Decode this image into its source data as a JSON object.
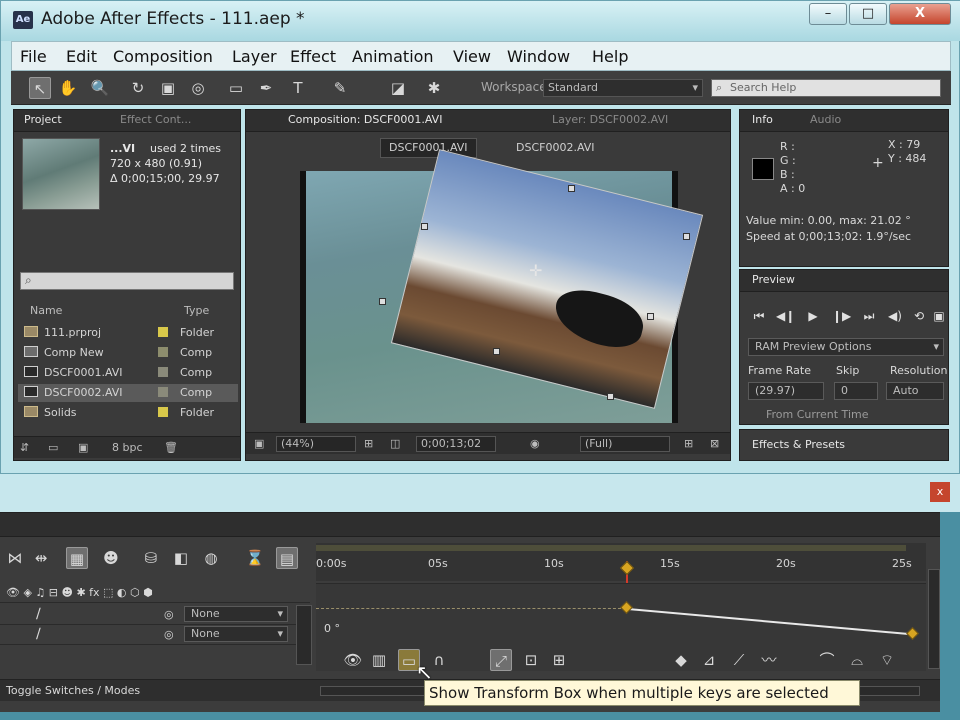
{
  "window": {
    "title": "Adobe After Effects - 111.aep *",
    "icon_text": "Ae",
    "controls": {
      "minimize": "–",
      "maximize": "□",
      "close": "X"
    }
  },
  "menu": [
    "File",
    "Edit",
    "Composition",
    "Layer",
    "Effect",
    "Animation",
    "View",
    "Window",
    "Help"
  ],
  "toolbar": {
    "tools": [
      "selection-tool-icon",
      "hand-tool-icon",
      "zoom-tool-icon",
      "rotation-tool-icon",
      "camera-tool-icon",
      "pan-behind-tool-icon",
      "rectangle-mask-tool-icon",
      "pen-tool-icon",
      "text-tool-icon",
      "brush-tool-icon",
      "eraser-tool-icon",
      "puppet-tool-icon"
    ],
    "tool_glyphs": [
      "↖",
      "✋",
      "🔍",
      "↻",
      "▣",
      "◎",
      "▭",
      "✒",
      "T",
      "✎",
      "◪",
      "✱"
    ],
    "workspace_label": "Workspace:",
    "workspace_value": "Standard",
    "search_placeholder": "Search Help"
  },
  "project_panel": {
    "tab_project": "Project",
    "tab_effect_controls": "Effect Cont...",
    "footage_name": "...VI",
    "footage_used": "used 2 times",
    "footage_size": "720 x 480 (0.91)",
    "footage_duration": "Δ 0;00;15;00, 29.97",
    "col_name": "Name",
    "col_type": "Type",
    "items": [
      {
        "name": "111.prproj",
        "type": "Folder",
        "icon": "folder",
        "label": "#d8c84a"
      },
      {
        "name": "Comp New",
        "type": "Comp",
        "icon": "comp",
        "label": "#8d8d6d"
      },
      {
        "name": "DSCF0001.AVI",
        "type": "Comp",
        "icon": "vid",
        "label": "#8a8a7a"
      },
      {
        "name": "DSCF0002.AVI",
        "type": "Comp",
        "icon": "vid",
        "label": "#8a8a7a"
      },
      {
        "name": "Solids",
        "type": "Folder",
        "icon": "folder",
        "label": "#d8c84a"
      }
    ],
    "footer_bpc": "8 bpc"
  },
  "composition_panel": {
    "tab_label": "Composition: DSCF0001.AVI",
    "tab_layer": "Layer: DSCF0002.AVI",
    "sub_tab_1": "DSCF0001.AVI",
    "sub_tab_2": "DSCF0002.AVI",
    "zoom": "(44%)",
    "timecode": "0;00;13;02",
    "resolution": "(Full)"
  },
  "info_panel": {
    "tab_info": "Info",
    "tab_audio": "Audio",
    "r": "R :",
    "g": "G :",
    "b": "B :",
    "a": "A : 0",
    "x": "X : 79",
    "y": "Y : 484",
    "value_line": "Value min: 0.00, max: 21.02 °",
    "speed_line": "Speed at 0;00;13;02: 1.9°/sec"
  },
  "preview_panel": {
    "tab": "Preview",
    "buttons": [
      "first-frame-icon",
      "prev-frame-icon",
      "play-icon",
      "next-frame-icon",
      "last-frame-icon",
      "audio-icon",
      "loop-icon",
      "ram-preview-icon"
    ],
    "button_glyphs": [
      "⏮",
      "◀❙",
      "▶",
      "❙▶",
      "⏭",
      "◀)",
      "⟲",
      "▣"
    ],
    "ram_options": "RAM Preview Options",
    "frame_rate_label": "Frame Rate",
    "skip_label": "Skip",
    "resolution_label": "Resolution",
    "frame_rate_value": "(29.97)",
    "skip_value": "0",
    "resolution_value": "Auto",
    "from_current": "From Current Time"
  },
  "effects_panel": {
    "tab": "Effects & Presets"
  },
  "timeline": {
    "ruler_labels": [
      "0:00s",
      "05s",
      "10s",
      "15s",
      "20s",
      "25s"
    ],
    "value_label": "0 °",
    "row_modes": [
      "None",
      "None"
    ],
    "switches_label": "Toggle Switches / Modes",
    "tooltip": "Show Transform Box when multiple keys are selected"
  }
}
